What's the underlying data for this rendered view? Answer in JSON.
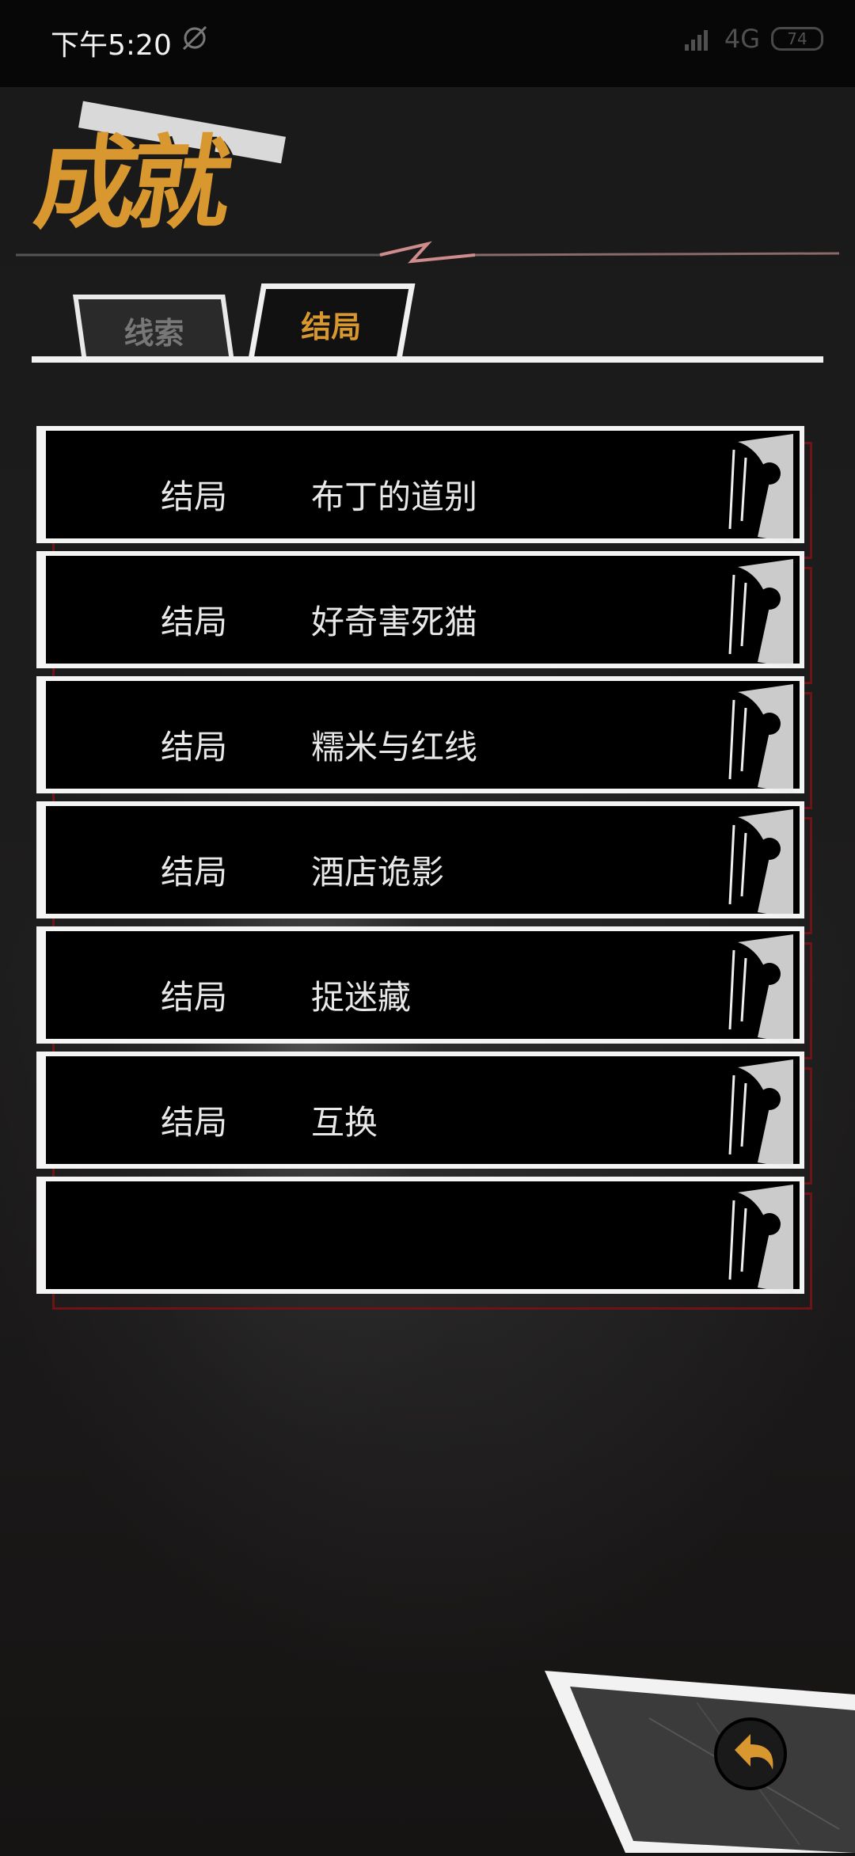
{
  "status_bar": {
    "time": "下午5:20",
    "network": "4G",
    "battery": "74",
    "icons": [
      "alarm-off-icon",
      "signal-icon",
      "battery-icon"
    ]
  },
  "header": {
    "title": "成就"
  },
  "tabs": [
    {
      "label": "线索",
      "active": false
    },
    {
      "label": "结局",
      "active": true
    }
  ],
  "endings": [
    {
      "type": "结局",
      "title": "布丁的道别"
    },
    {
      "type": "结局",
      "title": "好奇害死猫"
    },
    {
      "type": "结局",
      "title": "糯米与红线"
    },
    {
      "type": "结局",
      "title": "酒店诡影"
    },
    {
      "type": "结局",
      "title": "捉迷藏"
    },
    {
      "type": "结局",
      "title": "互换"
    },
    {
      "type": "",
      "title": ""
    }
  ],
  "colors": {
    "accent": "#d9982f",
    "card_bg": "#000000",
    "card_border": "#f4f4f4",
    "shadow_border": "#6e1414"
  },
  "back_button": {
    "icon": "back-arrow-icon"
  }
}
